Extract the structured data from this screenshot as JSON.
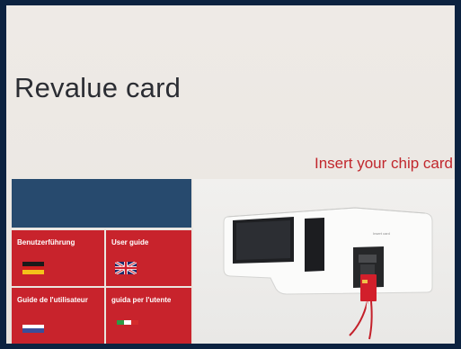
{
  "screen": {
    "title": "Revalue card",
    "insert_prompt": "Insert your chip card"
  },
  "guides": [
    {
      "label": "Benutzerführung",
      "flag": "german-flag-icon",
      "colors": [
        "#1a1a1a",
        "#d11f1f",
        "#f4c21a"
      ]
    },
    {
      "label": "User guide",
      "flag": "uk-flag-icon",
      "colors": [
        "#1d2c6b",
        "#ffffff",
        "#cf1f2e"
      ]
    },
    {
      "label": "Guide de l'utilisateur",
      "flag": "french-flag-icon",
      "colors": [
        "#c8232c",
        "#ffffff",
        "#3a4e9a"
      ]
    },
    {
      "label": "guida per l'utente",
      "flag": "italian-flag-icon",
      "colors": [
        "#2d9a45",
        "#ffffff",
        "#d42c2c"
      ]
    }
  ],
  "machine": {
    "label": "Insert card",
    "icon": "card-terminal-illustration"
  },
  "colors": {
    "accent_red": "#c1272d",
    "tile_red": "#c8232c",
    "banner_blue": "#274a6e"
  }
}
